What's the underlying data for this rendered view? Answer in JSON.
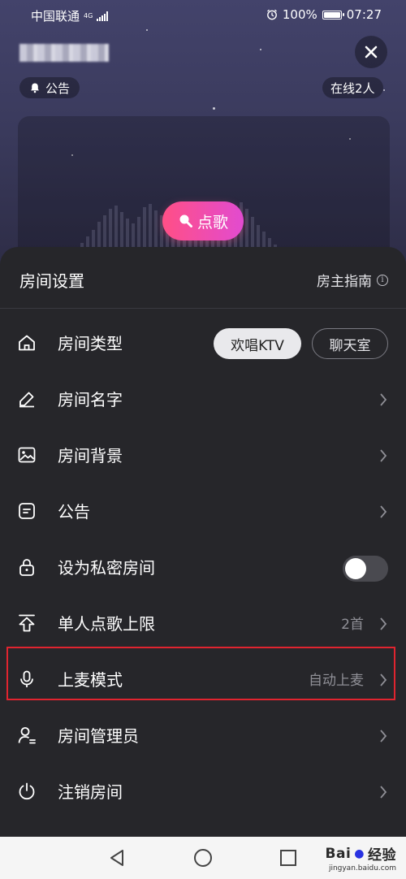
{
  "status_bar": {
    "carrier": "中国联通",
    "network": "4G",
    "battery_percent": "100%",
    "battery_level": 1.0,
    "time": "07:27"
  },
  "room": {
    "close_icon": "close-icon",
    "notice_label": "公告",
    "online_count": "在线2人",
    "song_button_label": "点歌"
  },
  "settings_panel": {
    "title": "房间设置",
    "guide_label": "房主指南",
    "rows": [
      {
        "icon": "home-icon",
        "label": "房间类型",
        "options": [
          "欢唱KTV",
          "聊天室"
        ],
        "selected": "欢唱KTV"
      },
      {
        "icon": "pencil-icon",
        "label": "房间名字"
      },
      {
        "icon": "image-icon",
        "label": "房间背景"
      },
      {
        "icon": "notice-icon",
        "label": "公告"
      },
      {
        "icon": "lock-icon",
        "label": "设为私密房间",
        "toggle_on": false
      },
      {
        "icon": "upload-limit-icon",
        "label": "单人点歌上限",
        "value": "2首"
      },
      {
        "icon": "microphone-icon",
        "label": "上麦模式",
        "value": "自动上麦"
      },
      {
        "icon": "admin-user-icon",
        "label": "房间管理员"
      },
      {
        "icon": "power-icon",
        "label": "注销房间"
      }
    ]
  },
  "watermark": {
    "logo_text": "Bai",
    "logo_suffix": "经验",
    "url": "jingyan.baidu.com"
  },
  "colors": {
    "accent_pink": "#ff4f86",
    "accent_purple": "#e24bd0",
    "panel_bg": "#26262a",
    "highlight_red": "#e0242f"
  }
}
